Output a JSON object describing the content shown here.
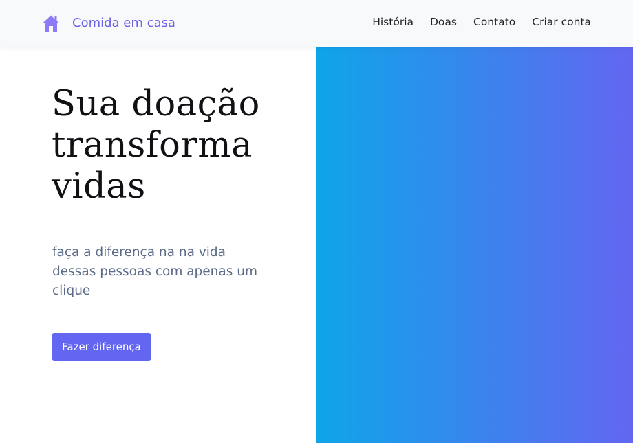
{
  "brand": {
    "name": "Comida em casa",
    "icon": "home-icon",
    "color": "#8b7cf6"
  },
  "nav": {
    "links": [
      "História",
      "Doas",
      "Contato",
      "Criar conta"
    ]
  },
  "hero": {
    "title_lines": [
      "Sua doação",
      "transforma",
      "vidas"
    ],
    "subtitle": "faça a diferença na na vida dessas pessoas com apenas um clique",
    "cta_label": "Fazer diferença"
  },
  "colors": {
    "accent": "#6366f1",
    "gradient_start": "#0ea5e9",
    "gradient_end": "#6366f1",
    "subtitle_text": "#5b6b88"
  }
}
